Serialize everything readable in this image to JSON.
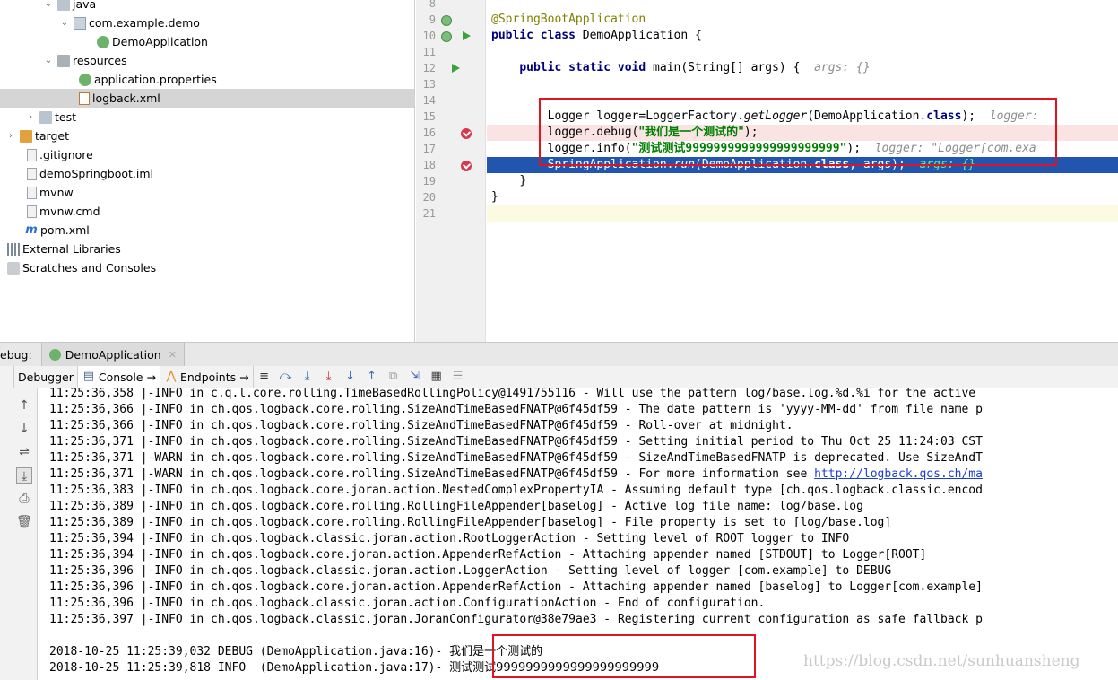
{
  "tree": {
    "items": [
      {
        "label": "java",
        "arrow": "⌄",
        "icon": "folder-icon",
        "indent": 1
      },
      {
        "label": "com.example.demo",
        "arrow": "⌄",
        "icon": "package-icon",
        "indent": 2
      },
      {
        "label": "DemoApplication",
        "arrow": "",
        "icon": "spring-class-icon",
        "indent": 3
      },
      {
        "label": "resources",
        "arrow": "⌄",
        "icon": "resources-folder-icon",
        "indent": 1
      },
      {
        "label": "application.properties",
        "arrow": "",
        "icon": "spring-properties-icon",
        "indent": 2
      },
      {
        "label": "logback.xml",
        "arrow": "",
        "icon": "xml-file-icon",
        "indent": 2
      },
      {
        "label": "test",
        "arrow": "›",
        "icon": "folder-icon",
        "indent": 0
      },
      {
        "label": "target",
        "arrow": "›",
        "icon": "orange-folder-icon",
        "indent": -1
      },
      {
        "label": ".gitignore",
        "arrow": "",
        "icon": "file-icon",
        "indent": -1
      },
      {
        "label": "demoSpringboot.iml",
        "arrow": "",
        "icon": "file-icon",
        "indent": -1
      },
      {
        "label": "mvnw",
        "arrow": "",
        "icon": "file-icon",
        "indent": -1
      },
      {
        "label": "mvnw.cmd",
        "arrow": "",
        "icon": "file-icon",
        "indent": -1
      },
      {
        "label": "pom.xml",
        "arrow": "",
        "icon": "maven-icon",
        "indent": -1
      },
      {
        "label": "External Libraries",
        "arrow": "",
        "icon": "libraries-icon",
        "indent": -2
      },
      {
        "label": "Scratches and Consoles",
        "arrow": "",
        "icon": "scratches-icon",
        "indent": -2
      }
    ],
    "selected": "logback.xml"
  },
  "editor": {
    "lines": [
      {
        "n": "8",
        "text": ""
      },
      {
        "n": "9",
        "text": "@SpringBootApplication"
      },
      {
        "n": "10",
        "text": "public class DemoApplication {"
      },
      {
        "n": "11",
        "text": ""
      },
      {
        "n": "12",
        "text": "public static void main(String[] args) {"
      },
      {
        "n": "13",
        "text": ""
      },
      {
        "n": "14",
        "text": ""
      },
      {
        "n": "15",
        "text": "Logger logger=LoggerFactory.getLogger(DemoApplication.class);"
      },
      {
        "n": "16",
        "text": "logger.debug(\"我们是一个测试的\");"
      },
      {
        "n": "17",
        "text": "logger.info(\"测试测试9999999999999999999999\");"
      },
      {
        "n": "18",
        "text": "SpringApplication.run(DemoApplication.class, args);"
      },
      {
        "n": "19",
        "text": "}"
      },
      {
        "n": "20",
        "text": "}"
      },
      {
        "n": "21",
        "text": ""
      }
    ],
    "hints": {
      "main": "args: {}",
      "l15": "logger:",
      "l17": "logger: \"Logger[com.exa",
      "l18": "args: {}"
    },
    "tokens": {
      "annotation": "@SpringBootApplication",
      "public": "public",
      "class": "class",
      "className": "DemoApplication {",
      "static": "static",
      "void": "void",
      "mainSig": "main(String[] args) {",
      "l15a": "Logger logger=LoggerFactory.",
      "l15b": "getLogger",
      "l15c": "(DemoApplication.",
      "l15d": "class",
      "l15e": ");",
      "l16a": "logger.debug(",
      "l16s": "\"我们是一个测试的\"",
      "l16e": ");",
      "l17a": "logger.info(",
      "l17s": "\"测试测试9999999999999999999999\"",
      "l17e": ");",
      "l18a": "SpringApplication.",
      "l18b": "run",
      "l18c": "(DemoApplication.",
      "l18d": "class",
      "l18e": ", args);",
      "close1": "}",
      "close2": "}"
    }
  },
  "debug": {
    "label": "ebug:",
    "run_config": "DemoApplication",
    "tabs": {
      "debugger": "Debugger",
      "console": "Console",
      "endpoints": "Endpoints"
    },
    "arrow": "→"
  },
  "console": {
    "lines": [
      "11:25:36,358 |-INFO in c.q.l.core.rolling.TimeBasedRollingPolicy@1491755116 - Will use the pattern log/base.log.%d.%i for the active",
      "11:25:36,366 |-INFO in ch.qos.logback.core.rolling.SizeAndTimeBasedFNATP@6f45df59 - The date pattern is 'yyyy-MM-dd' from file name p",
      "11:25:36,366 |-INFO in ch.qos.logback.core.rolling.SizeAndTimeBasedFNATP@6f45df59 - Roll-over at midnight.",
      "11:25:36,371 |-INFO in ch.qos.logback.core.rolling.SizeAndTimeBasedFNATP@6f45df59 - Setting initial period to Thu Oct 25 11:24:03 CST",
      "11:25:36,371 |-WARN in ch.qos.logback.core.rolling.SizeAndTimeBasedFNATP@6f45df59 - SizeAndTimeBasedFNATP is deprecated. Use SizeAndT",
      "11:25:36,371 |-WARN in ch.qos.logback.core.rolling.SizeAndTimeBasedFNATP@6f45df59 - For more information see ",
      "11:25:36,383 |-INFO in ch.qos.logback.core.joran.action.NestedComplexPropertyIA - Assuming default type [ch.qos.logback.classic.encod",
      "11:25:36,389 |-INFO in ch.qos.logback.core.rolling.RollingFileAppender[baselog] - Active log file name: log/base.log",
      "11:25:36,389 |-INFO in ch.qos.logback.core.rolling.RollingFileAppender[baselog] - File property is set to [log/base.log]",
      "11:25:36,394 |-INFO in ch.qos.logback.classic.joran.action.RootLoggerAction - Setting level of ROOT logger to INFO",
      "11:25:36,394 |-INFO in ch.qos.logback.core.joran.action.AppenderRefAction - Attaching appender named [STDOUT] to Logger[ROOT]",
      "11:25:36,396 |-INFO in ch.qos.logback.classic.joran.action.LoggerAction - Setting level of logger [com.example] to DEBUG",
      "11:25:36,396 |-INFO in ch.qos.logback.core.joran.action.AppenderRefAction - Attaching appender named [baselog] to Logger[com.example]",
      "11:25:36,396 |-INFO in ch.qos.logback.classic.joran.action.ConfigurationAction - End of configuration.",
      "11:25:36,397 |-INFO in ch.qos.logback.classic.joran.JoranConfigurator@38e79ae3 - Registering current configuration as safe fallback p"
    ],
    "link": "http://logback.qos.ch/ma",
    "debug_prefix": "2018-10-25 11:25:39,032 DEBUG (DemoApplication.java:16)- ",
    "debug_msg": "我们是一个测试的",
    "info_prefix": "2018-10-25 11:25:39,818 INFO  (DemoApplication.java:17)- ",
    "info_msg": "测试测试9999999999999999999999"
  },
  "watermark": "https://blog.csdn.net/sunhuansheng",
  "colors": {
    "breakpoint": "#d8374e",
    "execution_line": "#2155b0",
    "highlight_box": "#e0141e",
    "string": "#008000",
    "keyword": "#000080"
  }
}
